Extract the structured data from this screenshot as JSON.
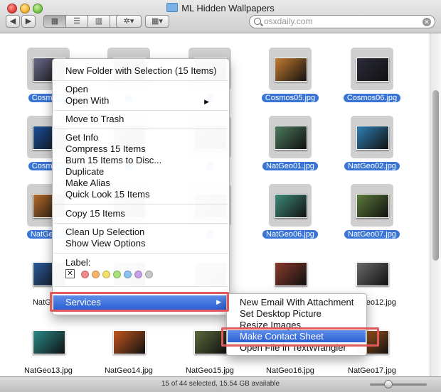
{
  "window": {
    "title": "ML Hidden Wallpapers"
  },
  "toolbar": {
    "search_text": "osxdaily.com",
    "back_glyph": "◀",
    "forward_glyph": "▶",
    "action_glyph": "✲▾",
    "arrange_glyph": "▦▾",
    "view_glyphs": [
      "▦",
      "☰",
      "▥",
      "▤"
    ]
  },
  "files": [
    {
      "name": "Cosmos0",
      "selected": true,
      "color": "#6a6a8a"
    },
    {
      "name": "",
      "selected": true,
      "color": "#333"
    },
    {
      "name": "",
      "selected": true,
      "color": "#333"
    },
    {
      "name": "Cosmos05.jpg",
      "selected": true,
      "color": "#c47b2f"
    },
    {
      "name": "Cosmos06.jpg",
      "selected": true,
      "color": "#2b2b3b"
    },
    {
      "name": "Cosmos0",
      "selected": true,
      "color": "#1b4f9a"
    },
    {
      "name": "",
      "selected": true,
      "color": "#555"
    },
    {
      "name": "",
      "selected": true,
      "color": "#555"
    },
    {
      "name": "NatGeo01.jpg",
      "selected": true,
      "color": "#4b7a5c"
    },
    {
      "name": "NatGeo02.jpg",
      "selected": true,
      "color": "#2f7fb5"
    },
    {
      "name": "NatGeo03",
      "selected": true,
      "color": "#b56b2a"
    },
    {
      "name": "",
      "selected": true,
      "color": "#777"
    },
    {
      "name": "",
      "selected": true,
      "color": "#777"
    },
    {
      "name": "NatGeo06.jpg",
      "selected": true,
      "color": "#3e8a7a"
    },
    {
      "name": "NatGeo07.jpg",
      "selected": true,
      "color": "#5a7a3a"
    },
    {
      "name": "NatGeo0",
      "selected": false,
      "color": "#2a5a9a"
    },
    {
      "name": "",
      "selected": false,
      "color": "#999"
    },
    {
      "name": "",
      "selected": false,
      "color": "#999"
    },
    {
      "name": "",
      "selected": false,
      "color": "#8a3a2a"
    },
    {
      "name": "NatGeo12.jpg",
      "selected": false,
      "color": "#6a6a6a"
    },
    {
      "name": "NatGeo13.jpg",
      "selected": false,
      "color": "#2a8a8a"
    },
    {
      "name": "NatGeo14.jpg",
      "selected": false,
      "color": "#c4561e"
    },
    {
      "name": "NatGeo15.jpg",
      "selected": false,
      "color": "#5a6a3a"
    },
    {
      "name": "NatGeo16.jpg",
      "selected": false,
      "color": "#8a6a4a"
    },
    {
      "name": "NatGeo17.jpg",
      "selected": false,
      "color": "#b8601e"
    }
  ],
  "context_menu": {
    "new_folder": "New Folder with Selection (15 Items)",
    "open": "Open",
    "open_with": "Open With",
    "move_to_trash": "Move to Trash",
    "get_info": "Get Info",
    "compress": "Compress 15 Items",
    "burn": "Burn 15 Items to Disc...",
    "duplicate": "Duplicate",
    "make_alias": "Make Alias",
    "quick_look": "Quick Look 15 Items",
    "copy": "Copy 15 Items",
    "clean_up": "Clean Up Selection",
    "show_view_options": "Show View Options",
    "label": "Label:",
    "label_x": "✕",
    "services": "Services",
    "arrow": "▶"
  },
  "label_colors": [
    "#f08a8a",
    "#f5b46a",
    "#f0e06a",
    "#a8e07a",
    "#8ac2f0",
    "#c8a0e8",
    "#c8c8c8"
  ],
  "submenu": {
    "new_email": "New Email With Attachment",
    "set_desktop": "Set Desktop Picture",
    "resize": "Resize Images",
    "contact_sheet": "Make Contact Sheet",
    "open_textwrangler": "Open File in TextWrangler"
  },
  "status": {
    "text": "15 of 44 selected, 15.54 GB available"
  }
}
